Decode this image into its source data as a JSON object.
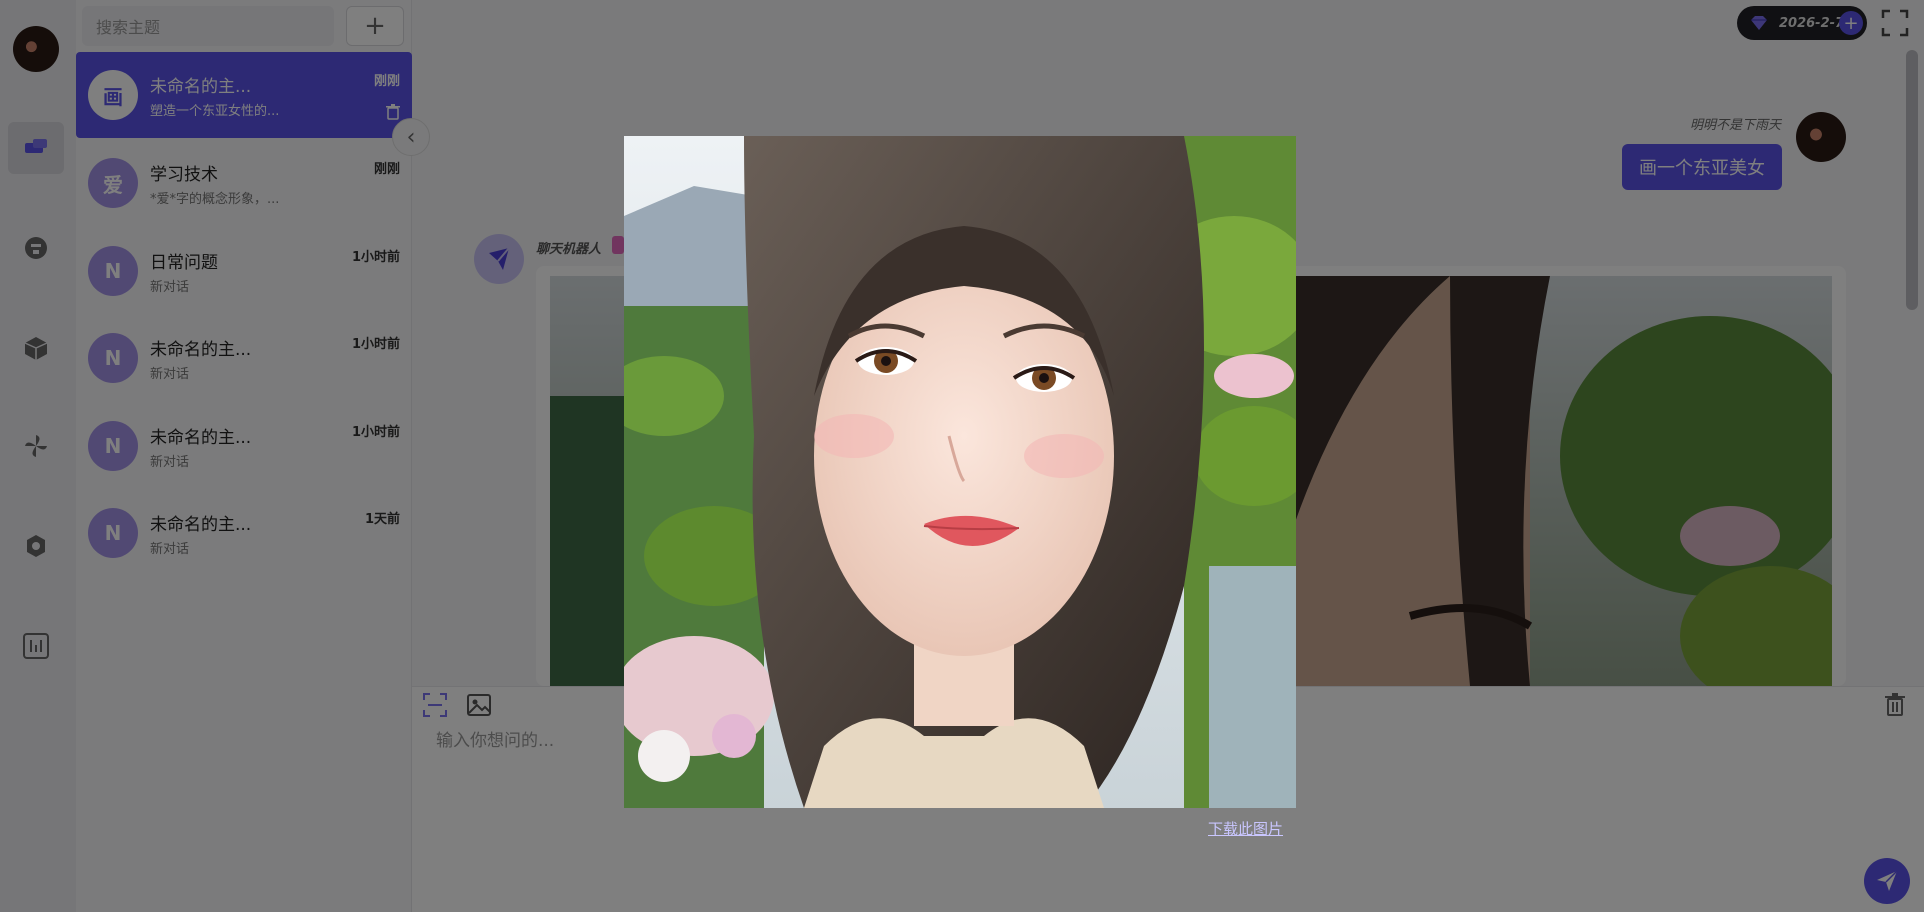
{
  "app": {
    "search": {
      "placeholder": "搜索主题"
    },
    "new_button": "+"
  },
  "rail": {
    "items": [
      {
        "icon": "chat-icon",
        "active": true
      },
      {
        "icon": "robot-icon",
        "active": false
      },
      {
        "icon": "cube-icon",
        "active": false
      },
      {
        "icon": "pinwheel-icon",
        "active": false
      },
      {
        "icon": "gear-icon",
        "active": false
      },
      {
        "icon": "sliders-icon",
        "active": false
      }
    ]
  },
  "conversations": [
    {
      "avatar": "画",
      "title": "未命名的主...",
      "subtitle": "塑造一个东亚女性的...",
      "time": "刚刚",
      "active": true
    },
    {
      "avatar": "爱",
      "title": "学习技术",
      "subtitle": "*爱*字的概念形象，...",
      "time": "刚刚",
      "active": false
    },
    {
      "avatar": "N",
      "title": "日常问题",
      "subtitle": "新对话",
      "time": "1小时前",
      "active": false
    },
    {
      "avatar": "N",
      "title": "未命名的主...",
      "subtitle": "新对话",
      "time": "1小时前",
      "active": false
    },
    {
      "avatar": "N",
      "title": "未命名的主...",
      "subtitle": "新对话",
      "time": "1小时前",
      "active": false
    },
    {
      "avatar": "N",
      "title": "未命名的主...",
      "subtitle": "新对话",
      "time": "1天前",
      "active": false
    }
  ],
  "header": {
    "date": "2026-2-7",
    "accent": "#5a52e8"
  },
  "chat": {
    "user_name": "明明不是下雨天",
    "user_message": "画一个东亚美女",
    "bot_name": "聊天机器人"
  },
  "input": {
    "placeholder": "输入你想问的..."
  },
  "lightbox": {
    "download_label": "下载此图片"
  }
}
